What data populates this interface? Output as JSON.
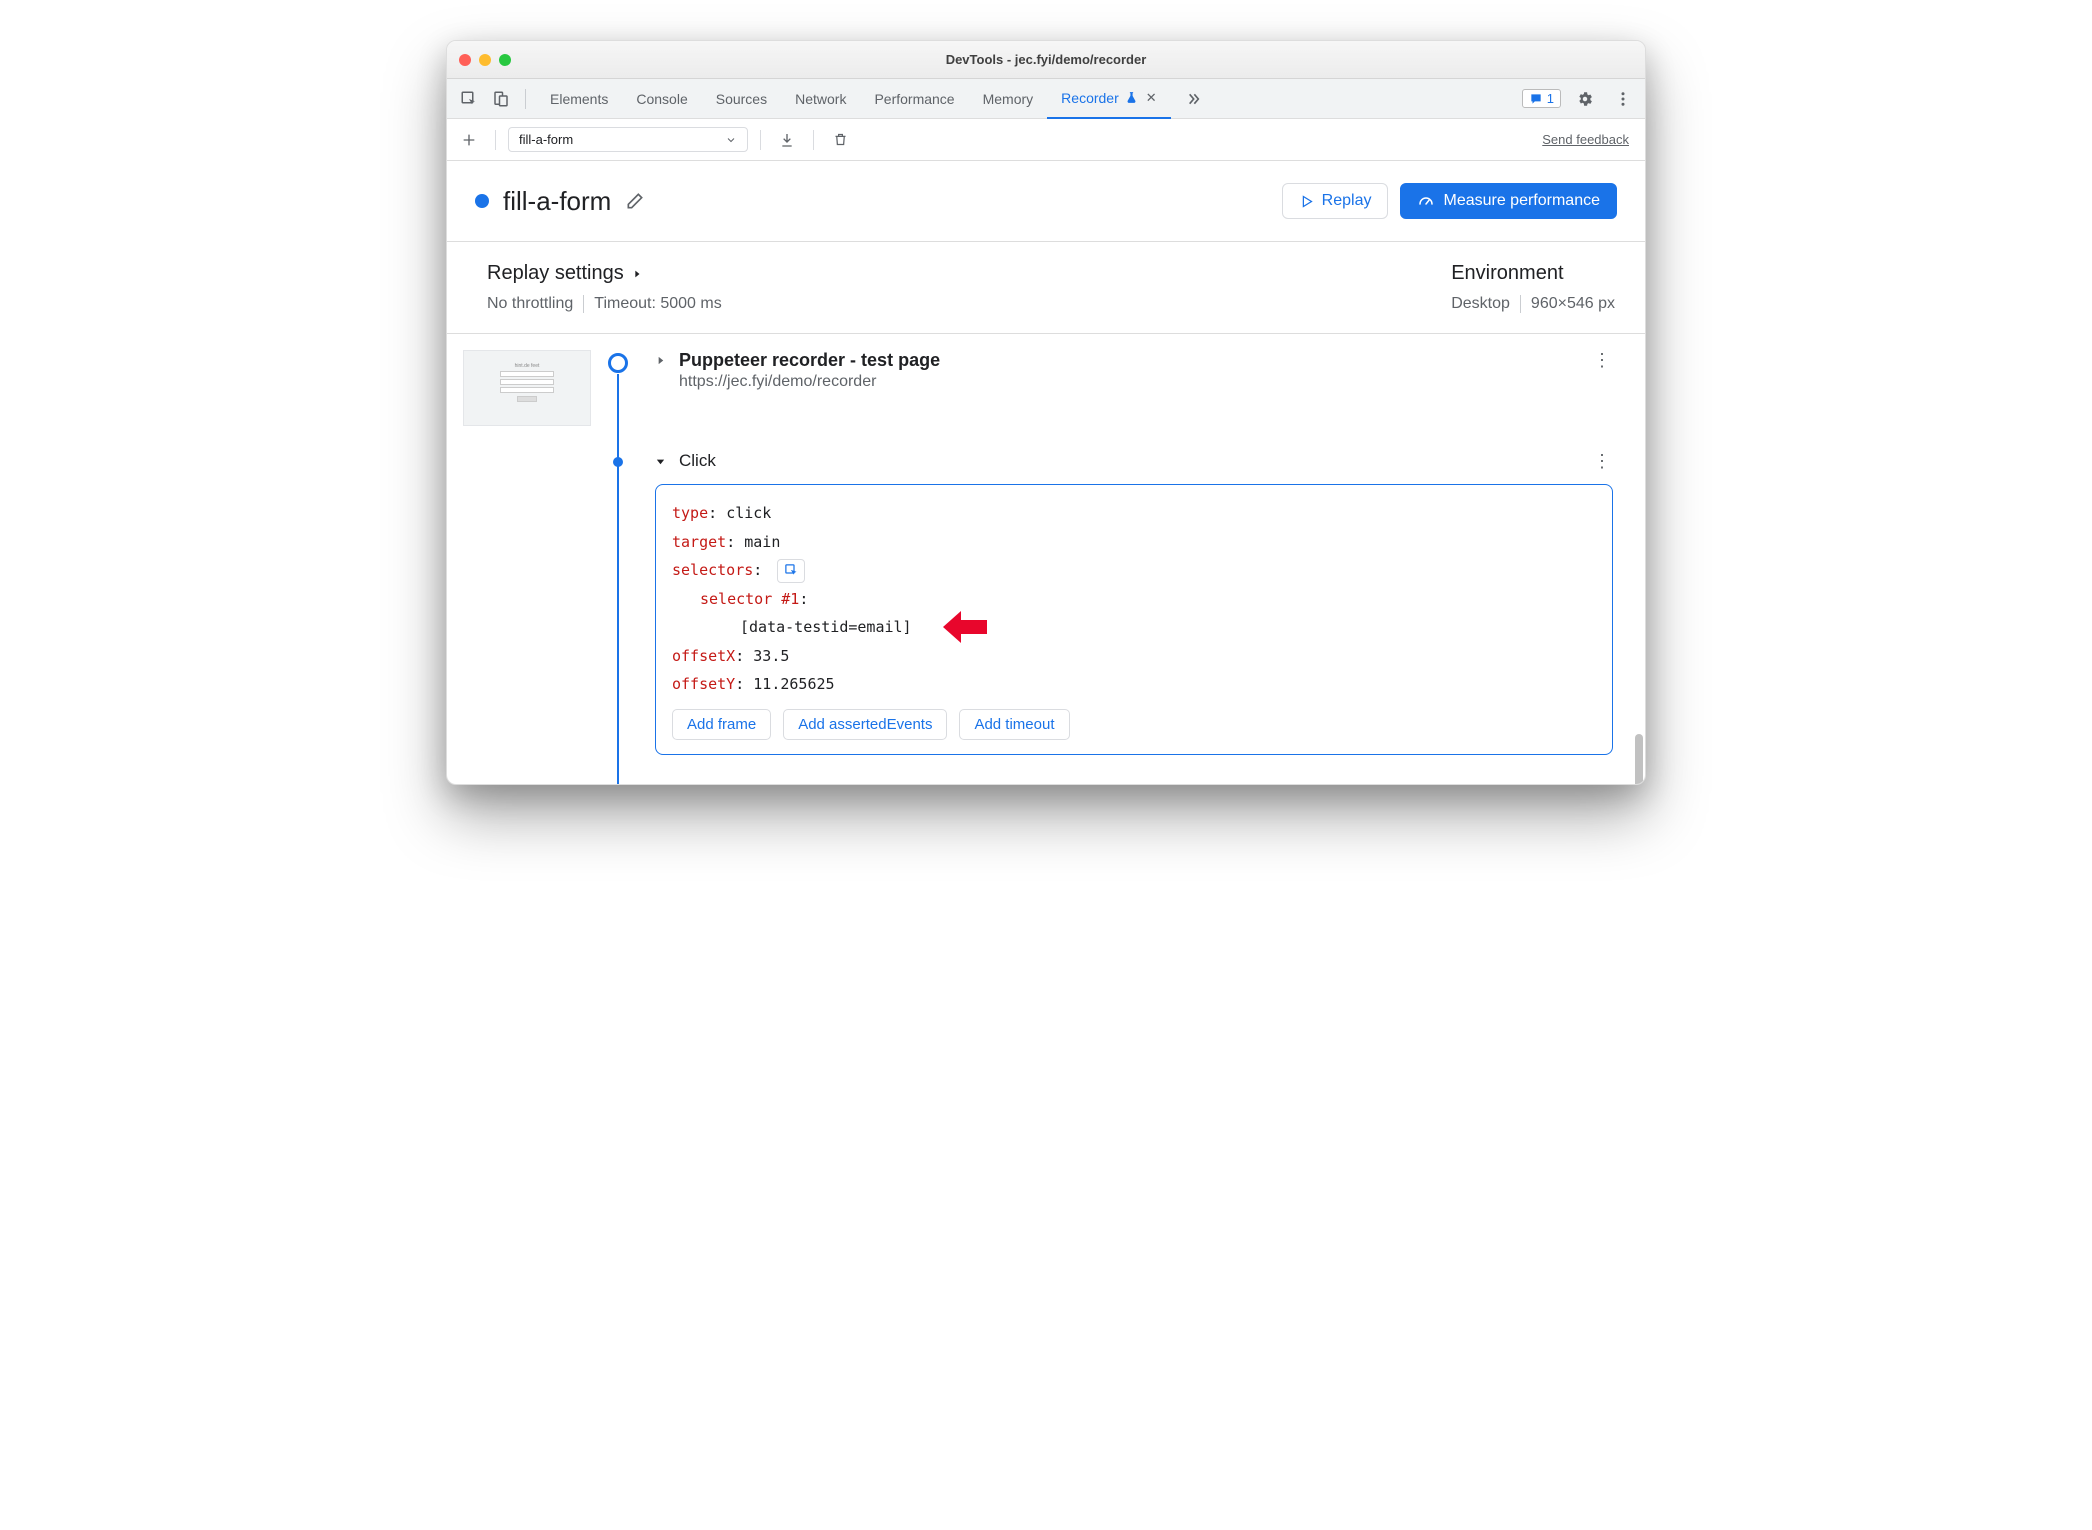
{
  "window": {
    "title": "DevTools - jec.fyi/demo/recorder"
  },
  "tabs": {
    "items": [
      "Elements",
      "Console",
      "Sources",
      "Network",
      "Performance",
      "Memory"
    ],
    "active": "Recorder",
    "issueCount": "1"
  },
  "recorderBar": {
    "selected": "fill-a-form",
    "feedback": "Send feedback"
  },
  "header": {
    "recordingName": "fill-a-form",
    "replayBtn": "Replay",
    "measureBtn": "Measure performance"
  },
  "settings": {
    "replayTitle": "Replay settings",
    "throttling": "No throttling",
    "timeout": "Timeout: 5000 ms",
    "envTitle": "Environment",
    "device": "Desktop",
    "viewport": "960×546 px"
  },
  "steps": {
    "s1": {
      "title": "Puppeteer recorder - test page",
      "url": "https://jec.fyi/demo/recorder"
    },
    "s2": {
      "title": "Click",
      "props": {
        "typeKey": "type",
        "typeVal": "click",
        "targetKey": "target",
        "targetVal": "main",
        "selectorsKey": "selectors",
        "selector1Key": "selector #1",
        "selector1Val": "[data-testid=email]",
        "offXKey": "offsetX",
        "offXVal": "33.5",
        "offYKey": "offsetY",
        "offYVal": "11.265625"
      },
      "buttons": {
        "addFrame": "Add frame",
        "addAsserted": "Add assertedEvents",
        "addTimeout": "Add timeout"
      }
    }
  }
}
